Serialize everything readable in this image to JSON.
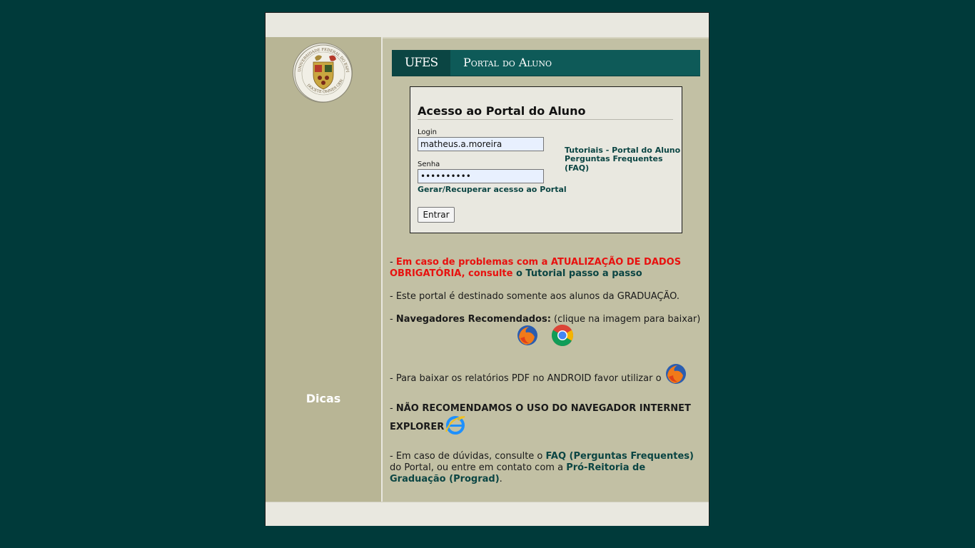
{
  "header": {
    "ufes_label": "UFES",
    "portal_label": "Portal do Aluno"
  },
  "seal": {
    "top_text": "UNIVERSIDADE FEDERAL DO ESPÍRITO SANTO",
    "bottom_text": "DOCETE OMNES GENTES"
  },
  "sidebar": {
    "dicas_label": "Dicas"
  },
  "login": {
    "title": "Acesso ao Portal do Aluno",
    "login_label": "Login",
    "login_value": "matheus.a.moreira",
    "password_label": "Senha",
    "password_value": "••••••••••",
    "recover_link": "Gerar/Recuperar acesso ao Portal",
    "submit_label": "Entrar",
    "tutorials_link": "Tutoriais - Portal do Aluno",
    "faq_link": "Perguntas Frequentes (FAQ)"
  },
  "tips": {
    "dash": "- ",
    "update_red": "Em caso de problemas com a ATUALIZAÇÃO DE DADOS OBRIGATÓRIA, consulte",
    "update_link": " o Tutorial passo a passo",
    "graduation": "- Este portal é destinado somente aos alunos da GRADUAÇÃO.",
    "browsers_bold": "Navegadores Recomendados:",
    "browsers_rest": " (clique na imagem para baixar)",
    "android": "- Para baixar os relatórios PDF no ANDROID favor utilizar o",
    "ie_warning": "NÃO RECOMENDAMOS O USO DO NAVEGADOR INTERNET EXPLORER",
    "doubts_1": "- Em caso de dúvidas, consulte o ",
    "faq_link": "FAQ (Perguntas Frequentes)",
    "doubts_2": " do Portal, ou entre em contato com a ",
    "prograd_link": "Pró-Reitoria de Graduação (Prograd)",
    "doubts_end": "."
  },
  "colors": {
    "background": "#003a3a",
    "banner": "#0e5a58",
    "sidebar": "#b8b595",
    "content": "#c2c0a4",
    "link": "#0b4543",
    "warning": "#e8110f"
  },
  "icons": [
    "firefox-icon",
    "chrome-icon",
    "internet-explorer-icon",
    "university-seal-icon"
  ]
}
